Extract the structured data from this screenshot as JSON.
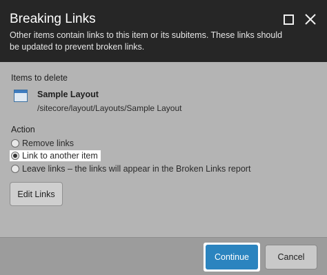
{
  "dialog": {
    "title": "Breaking Links",
    "subtitle": "Other items contain links to this item or its subitems. These links should be updated to prevent broken links."
  },
  "items_section": {
    "label": "Items to delete",
    "item": {
      "icon": "layout-icon",
      "name": "Sample Layout",
      "path": "/sitecore/layout/Layouts/Sample Layout"
    }
  },
  "action_section": {
    "label": "Action",
    "options": [
      {
        "label": "Remove links",
        "checked": false
      },
      {
        "label": "Link to another item",
        "checked": true
      },
      {
        "label": "Leave links – the links will appear in the Broken Links report",
        "checked": false
      }
    ],
    "edit_links_label": "Edit Links"
  },
  "footer": {
    "continue_label": "Continue",
    "cancel_label": "Cancel"
  },
  "colors": {
    "header_bg": "#262626",
    "body_bg": "#b4b4b4",
    "primary_button": "#2b84bf"
  }
}
